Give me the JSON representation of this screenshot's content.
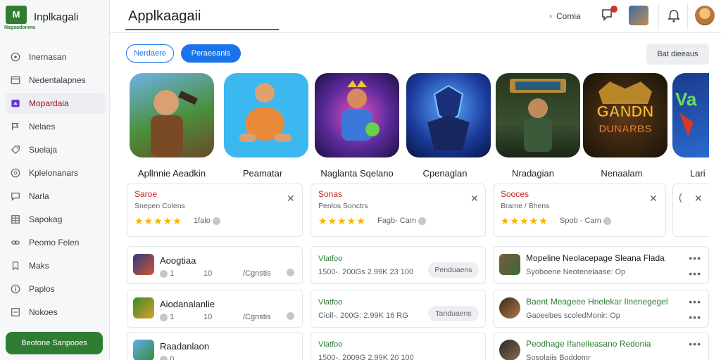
{
  "app": {
    "brand": "Inplkagali",
    "logo_text": "M",
    "logo_sub": "Nagaadonmo",
    "title": "Applkaagaii"
  },
  "sidebar": {
    "items": [
      {
        "label": "Inernasan",
        "icon": "compass-icon",
        "active": false
      },
      {
        "label": "Nedentalapnes",
        "icon": "folder-icon",
        "active": false
      },
      {
        "label": "Mopardaia",
        "icon": "gamepad-icon",
        "active": true
      },
      {
        "label": "Nelaes",
        "icon": "flag-icon",
        "active": false
      },
      {
        "label": "Suelaja",
        "icon": "tag-icon",
        "active": false
      },
      {
        "label": "Kplelonanars",
        "icon": "globe-icon",
        "active": false
      },
      {
        "label": "Narla",
        "icon": "chat-icon",
        "active": false
      },
      {
        "label": "Sapokag",
        "icon": "grid-icon",
        "active": false
      },
      {
        "label": "Peomo Felen",
        "icon": "link-icon",
        "active": false
      },
      {
        "label": "Maks",
        "icon": "bookmark-icon",
        "active": false
      },
      {
        "label": "Paplos",
        "icon": "info-icon",
        "active": false
      },
      {
        "label": "Nokoes",
        "icon": "square-icon",
        "active": false
      }
    ],
    "cta_label": "Beotone Sanpooes"
  },
  "header": {
    "comms": "Comia",
    "comms_prefix": "›"
  },
  "filters": {
    "chip1": "Nerdaere",
    "chip2": "Peraeeanis",
    "sort": "Bat dieeaus"
  },
  "games": [
    {
      "label": "Apllnnie Aeadkin"
    },
    {
      "label": "Peamatar"
    },
    {
      "label": "Naglanta Sqelano"
    },
    {
      "label": "Cpenaglan"
    },
    {
      "label": "Nradagian"
    },
    {
      "label": "Nenaalam"
    },
    {
      "label": "Lari"
    }
  ],
  "game_badge": {
    "line1": "GANDN",
    "line2": "DUNARBS"
  },
  "ratings": [
    {
      "title": "Saroe",
      "sub": "Snepen Colens",
      "stars": "★★★★★",
      "meta": "1falo"
    },
    {
      "title": "Sonas",
      "sub": "Penlos Sonctrs",
      "stars": "★★★★★",
      "meta": "Fagb- Cam"
    },
    {
      "title": "Sooces",
      "sub": "Brame / Bhens",
      "stars": "★★★★★",
      "meta": "Spob - Cam"
    }
  ],
  "list_left": [
    {
      "name": "Aoogtiaa",
      "a": "1",
      "b": "10",
      "c": "/Cgnstis"
    },
    {
      "name": "Aiodanalanlie",
      "a": "1",
      "b": "10",
      "c": "/Cgnstis"
    },
    {
      "name": "Raadanlaon",
      "a": "0",
      "b": "",
      "c": ""
    }
  ],
  "list_mid": [
    {
      "v1": "Vlatfoo",
      "v2": "1500-. 200Gs 2.99K 23 100",
      "pill": "Penduaens"
    },
    {
      "v1": "Vlatfoo",
      "v2": "Cioll-. 200G: 2.99K 16 RG",
      "pill": "Tanduaens"
    },
    {
      "v1": "Vlatfoo",
      "v2": "1500-. 2009G 2.99K 20 100",
      "pill": ""
    }
  ],
  "list_right": [
    {
      "t1": "Mopeline Neolacepage Sleana Flada",
      "t2": "Syoboene Neotenelaase: Op",
      "green": false
    },
    {
      "t1": "Baent Meageee Hnelekar Ilnenegegel",
      "t2": "Gaoeebes scoledMonir: Op",
      "green": true
    },
    {
      "t1": "Peodhage Ifanelleasano Redonia",
      "t2": "Sosolaiis Boddomr",
      "green": true
    }
  ],
  "colors": {
    "accent": "#1a73e8",
    "brand_green": "#2e7d32",
    "star": "#f4b400",
    "rating_title": "#c5221f"
  }
}
